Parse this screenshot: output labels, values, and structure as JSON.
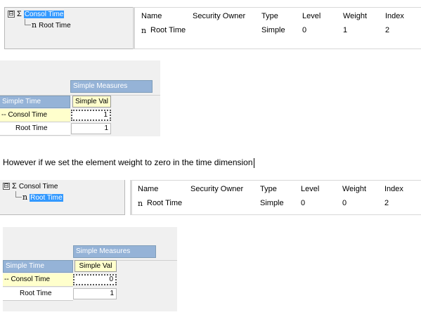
{
  "shot1": {
    "tree": {
      "expander": "⊟",
      "consol_label": "Consol Time",
      "root_label": "Root Time",
      "sigma": "Σ",
      "n_glyph": "n"
    },
    "list": {
      "headers": [
        "Name",
        "Security Owner",
        "Type",
        "Level",
        "Weight",
        "Index"
      ],
      "row": {
        "name": "Root Time",
        "type": "Simple",
        "level": "0",
        "weight": "1",
        "index": "2"
      }
    },
    "viewer": {
      "col_dim": "Simple Measures",
      "row_dim": "Simple Time",
      "col_member": "Simple Val",
      "rows": [
        {
          "label": "-- Consol Time",
          "value": "1"
        },
        {
          "label": "Root Time",
          "value": "1"
        }
      ]
    }
  },
  "caption": "However if we set the element weight to zero in the time dimension",
  "shot2": {
    "tree": {
      "expander": "⊟",
      "consol_label": "Consol Time",
      "root_label": "Root Time",
      "sigma": "Σ",
      "n_glyph": "n"
    },
    "list": {
      "headers": [
        "Name",
        "Security Owner",
        "Type",
        "Level",
        "Weight",
        "Index"
      ],
      "row": {
        "name": "Root Time",
        "type": "Simple",
        "level": "0",
        "weight": "0",
        "index": "2"
      }
    },
    "viewer": {
      "col_dim": "Simple Measures",
      "row_dim": "Simple Time",
      "col_member": "Simple Val",
      "rows": [
        {
          "label": "-- Consol Time",
          "value": "0"
        },
        {
          "label": "Root Time",
          "value": "1"
        }
      ]
    }
  },
  "colors": {
    "selection": "#3399ff",
    "dimension_header": "#95b3d7",
    "consolidated_row": "#ffffcc"
  }
}
